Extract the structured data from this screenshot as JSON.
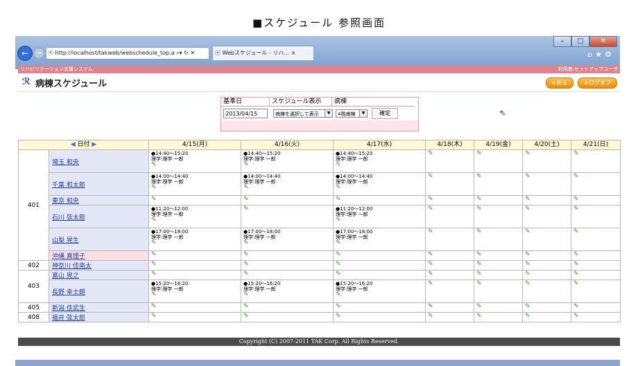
{
  "caption": "■スケジュール 参照画面",
  "browser": {
    "url": "http://localhost/takweb/webschedule_top.a",
    "tab_title": "Webスケジュール - リハ...",
    "tab_close": "×"
  },
  "app": {
    "system_name": "リハビリテーション支援システム",
    "user_label": "利用者:セットアップユーザ",
    "page_title": "病棟スケジュール",
    "back_label": "戻る",
    "logoff_label": "ログオフ"
  },
  "filter": {
    "headers": [
      "基準日",
      "スケジュール表示",
      "病棟"
    ],
    "date_value": "2013/04/15",
    "display_value": "病棟を選択して表示",
    "ward_value": "4階病棟",
    "confirm_label": "確定"
  },
  "schedule": {
    "date_header": "日付",
    "days": [
      "4/15(月)",
      "4/16(火)",
      "4/17(水)",
      "4/18(木)",
      "4/19(金)",
      "4/20(土)",
      "4/21(日)"
    ],
    "rooms": [
      {
        "room": "401",
        "patients": [
          {
            "name": "埼玉 和央",
            "highlight": false,
            "cells": [
              [
                {
                  "time": "●14:40～15:20",
                  "staff": "理学:理学 一郎"
                }
              ],
              [
                {
                  "time": "●14:40～15:20",
                  "staff": "理学:理学 一郎"
                }
              ],
              [
                {
                  "time": "●14:40～15:20",
                  "staff": "理学:理学 一郎"
                }
              ],
              [],
              [],
              [],
              []
            ]
          },
          {
            "name": "千葉 和太郎",
            "highlight": false,
            "cells": [
              [
                {
                  "time": "●14:00～14:40",
                  "staff": "理学:理学 一郎"
                }
              ],
              [
                {
                  "time": "●14:00～14:40",
                  "staff": "理学:理学 一郎"
                }
              ],
              [
                {
                  "time": "●14:00～14:40",
                  "staff": "理学:理学 一郎"
                }
              ],
              [],
              [],
              [],
              []
            ]
          },
          {
            "name": "東京 和央",
            "highlight": false,
            "cells": [
              [],
              [],
              [],
              [],
              [],
              [],
              []
            ]
          },
          {
            "name": "石川 弦太郎",
            "highlight": false,
            "cells": [
              [
                {
                  "time": "●11:20～12:00",
                  "staff": "理学:理学 一郎"
                }
              ],
              [],
              [
                {
                  "time": "●11:20～12:00",
                  "staff": "理学:理学 一郎"
                }
              ],
              [],
              [],
              [],
              []
            ]
          },
          {
            "name": "山梨 晃生",
            "highlight": false,
            "cells": [
              [
                {
                  "time": "●17:00～18:00",
                  "staff": "理学:理学 一郎"
                }
              ],
              [
                {
                  "time": "●17:00～18:00",
                  "staff": "理学:理学 一郎"
                }
              ],
              [
                {
                  "time": "●17:00～18:00",
                  "staff": "理学:理学 一郎"
                }
              ],
              [],
              [],
              [],
              []
            ]
          },
          {
            "name": "沖縄 真理子",
            "highlight": true,
            "cells": [
              [],
              [],
              [],
              [],
              [],
              [],
              []
            ]
          }
        ]
      },
      {
        "room": "402",
        "patients": [
          {
            "name": "神奈川 佳南太",
            "highlight": false,
            "cells": [
              [],
              [],
              [],
              [],
              [],
              [],
              []
            ]
          }
        ]
      },
      {
        "room": "403",
        "patients": [
          {
            "name": "富山 晃之",
            "highlight": false,
            "cells": [
              [],
              [],
              [],
              [],
              [],
              [],
              []
            ]
          },
          {
            "name": "長野 幸士朗",
            "highlight": false,
            "cells": [
              [
                {
                  "time": "●15:20～16:20",
                  "staff": "理学:理学 一郎"
                }
              ],
              [
                {
                  "time": "●15:20～16:20",
                  "staff": "理学:理学 一郎"
                }
              ],
              [
                {
                  "time": "●15:20～16:20",
                  "staff": "理学:理学 一郎"
                }
              ],
              [],
              [],
              [],
              []
            ]
          }
        ]
      },
      {
        "room": "405",
        "patients": [
          {
            "name": "新潟 佳武生",
            "highlight": false,
            "cells": [
              [],
              [],
              [],
              [],
              [],
              [],
              []
            ]
          }
        ]
      },
      {
        "room": "408",
        "patients": [
          {
            "name": "福井 弦太郎",
            "highlight": false,
            "cells": [
              [],
              [],
              [],
              [],
              [],
              [],
              []
            ]
          }
        ]
      }
    ]
  },
  "footer": "Copyright (C) 2007-2011 TAK Corp. All Rights Reserved.",
  "colors": {
    "pink_bar": "#d9848f",
    "header_yellow": "#fff9d6",
    "name_blue": "#e4e8f6",
    "button_orange": "#ee8a00"
  },
  "icons": {
    "add_schedule": "pencil-add-icon",
    "prev": "prev-arrow-icon",
    "next": "next-arrow-icon"
  }
}
